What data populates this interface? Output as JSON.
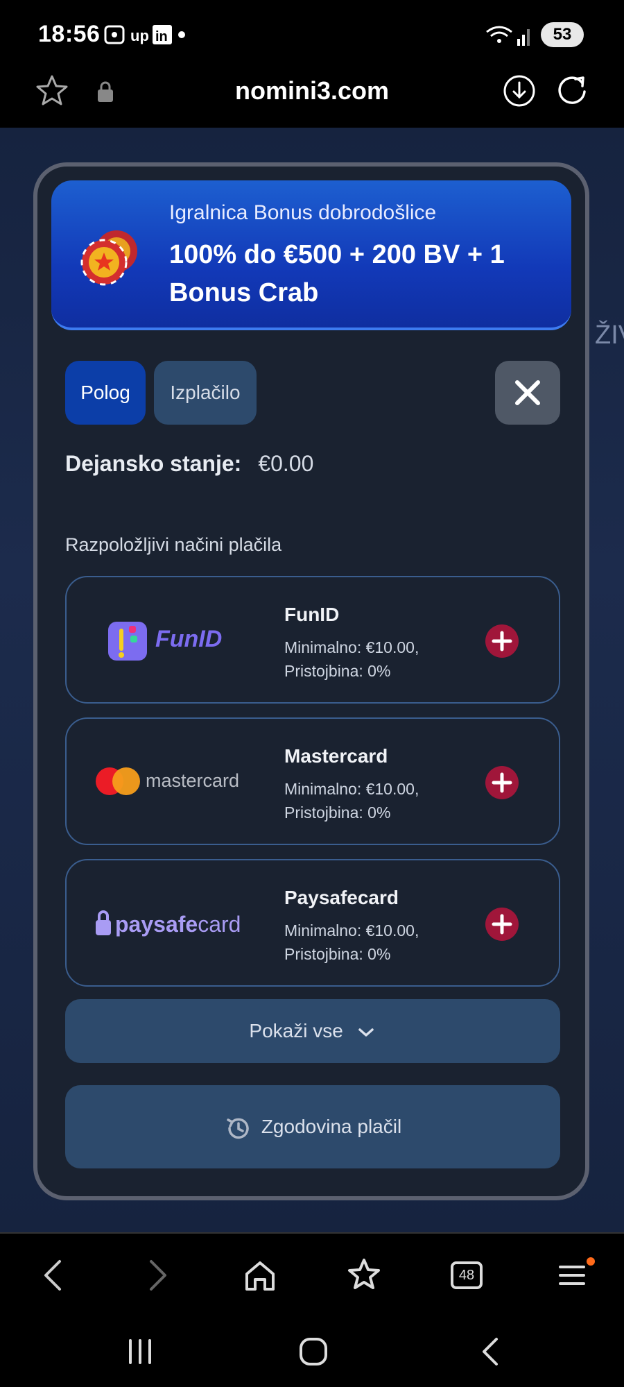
{
  "status_bar": {
    "time": "18:56",
    "notification_icons": [
      "screenshot-icon",
      "up-icon",
      "linkedin-icon",
      "dot-icon"
    ],
    "battery": "53"
  },
  "browser": {
    "url": "nomini3.com",
    "tab_count": "48"
  },
  "background_page": {
    "faint_text": "ŽIV"
  },
  "modal": {
    "banner": {
      "subtitle": "Igralnica Bonus dobrodošlice",
      "title": "100% do €500 + 200 BV + 1 Bonus Crab"
    },
    "tabs": [
      {
        "label": "Polog",
        "active": true
      },
      {
        "label": "Izplačilo",
        "active": false
      }
    ],
    "balance": {
      "label": "Dejansko stanje:",
      "value": "€0.00"
    },
    "methods_heading": "Razpoložljivi načini plačila",
    "methods": [
      {
        "name": "FunID",
        "logo_text": "FunID",
        "min": "Minimalno: €10.00,",
        "fee": "Pristojbina: 0%"
      },
      {
        "name": "Mastercard",
        "logo_text": "mastercard",
        "min": "Minimalno: €10.00,",
        "fee": "Pristojbina: 0%"
      },
      {
        "name": "Paysafecard",
        "logo_text_bold": "paysafe",
        "logo_text_light": "card",
        "min": "Minimalno: €10.00,",
        "fee": "Pristojbina: 0%"
      }
    ],
    "show_all": "Pokaži vse",
    "history": "Zgodovina plačil"
  },
  "colors": {
    "accent_blue": "#0c3ea8",
    "button_bg": "#2d4a6c",
    "plus_red": "#a0163a",
    "funid_purple": "#7c6cf0"
  }
}
